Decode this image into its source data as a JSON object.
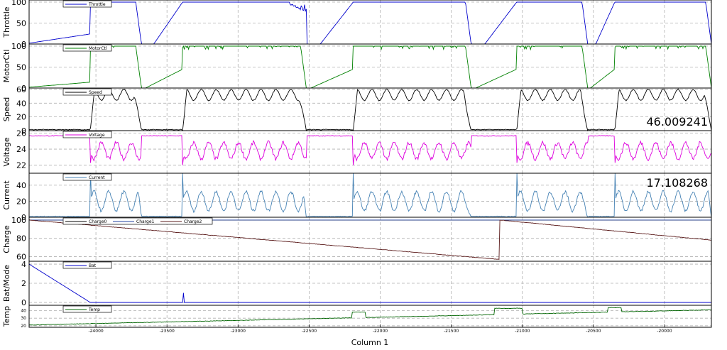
{
  "chart_data": {
    "type": "line",
    "xlabel": "Column 1",
    "xlim": [
      -24470,
      -19670
    ],
    "x_ticks": [
      -24000,
      -23500,
      -23000,
      -22500,
      -22000,
      -21500,
      -21000,
      -20500,
      -20000
    ],
    "x_tick_labels": [
      "-24000",
      "-23500",
      "-23000",
      "-22500",
      "-22000",
      "-21500",
      "-21000",
      "-20500",
      "-20000"
    ],
    "segments": [
      {
        "start": -24040,
        "end": -23680
      },
      {
        "start": -23390,
        "end": -22520
      },
      {
        "start": -22190,
        "end": -21360
      },
      {
        "start": -21040,
        "end": -20540
      },
      {
        "start": -20350,
        "end": -19670
      }
    ],
    "panels": [
      {
        "ylabel": "Throttle",
        "ylim": [
          0,
          105
        ],
        "yticks": [
          0,
          50,
          100
        ],
        "legend": [
          "Throttle"
        ],
        "series": [
          {
            "name": "Throttle",
            "color": "#0000cc",
            "kind": "throttle"
          }
        ]
      },
      {
        "ylabel": "MotorCtl",
        "ylim": [
          0,
          105
        ],
        "yticks": [
          0,
          50,
          100
        ],
        "legend": [
          "MotorCtl"
        ],
        "series": [
          {
            "name": "MotorCtl",
            "color": "#008000",
            "kind": "motor"
          }
        ]
      },
      {
        "ylabel": "Speed",
        "ylim": [
          0,
          62
        ],
        "yticks": [
          0,
          20,
          40,
          60
        ],
        "legend": [
          "Speed"
        ],
        "readout": "46.009241",
        "series": [
          {
            "name": "Speed",
            "color": "#000000",
            "kind": "speed"
          }
        ]
      },
      {
        "ylabel": "Voltage",
        "ylim": [
          21,
          26.3
        ],
        "yticks": [
          22,
          24,
          26
        ],
        "legend": [
          "Voltage"
        ],
        "series": [
          {
            "name": "Voltage",
            "color": "#dd00dd",
            "kind": "voltage"
          }
        ]
      },
      {
        "ylabel": "Current",
        "ylim": [
          0,
          55
        ],
        "yticks": [
          0,
          20,
          40
        ],
        "legend": [
          "Current"
        ],
        "readout": "17.108268",
        "series": [
          {
            "name": "Current",
            "color": "#4682b4",
            "kind": "current"
          }
        ]
      },
      {
        "ylabel": "Charge",
        "ylim": [
          55,
          103
        ],
        "yticks": [
          60,
          80,
          100
        ],
        "legend": [
          "Charge0",
          "Charge1",
          "Charge2"
        ],
        "series": [
          {
            "name": "Charge0",
            "color": "#000000",
            "kind": "flat100"
          },
          {
            "name": "Charge1",
            "color": "#1f3f9f",
            "kind": "flat100"
          },
          {
            "name": "Charge2",
            "color": "#5a1a1a",
            "kind": "charge"
          }
        ]
      },
      {
        "ylabel": "Bat/Mode",
        "ylim": [
          -0.3,
          4.3
        ],
        "yticks": [
          0,
          2,
          4
        ],
        "legend": [
          "Bat"
        ],
        "series": [
          {
            "name": "Bat",
            "color": "#0000cc",
            "kind": "bat"
          }
        ]
      },
      {
        "ylabel": "Temp",
        "ylim": [
          18,
          47
        ],
        "yticks": [
          20,
          30,
          40
        ],
        "small_ticks": true,
        "legend": [
          "Temp"
        ],
        "series": [
          {
            "name": "Temp",
            "color": "#006400",
            "kind": "temp"
          }
        ]
      }
    ]
  }
}
